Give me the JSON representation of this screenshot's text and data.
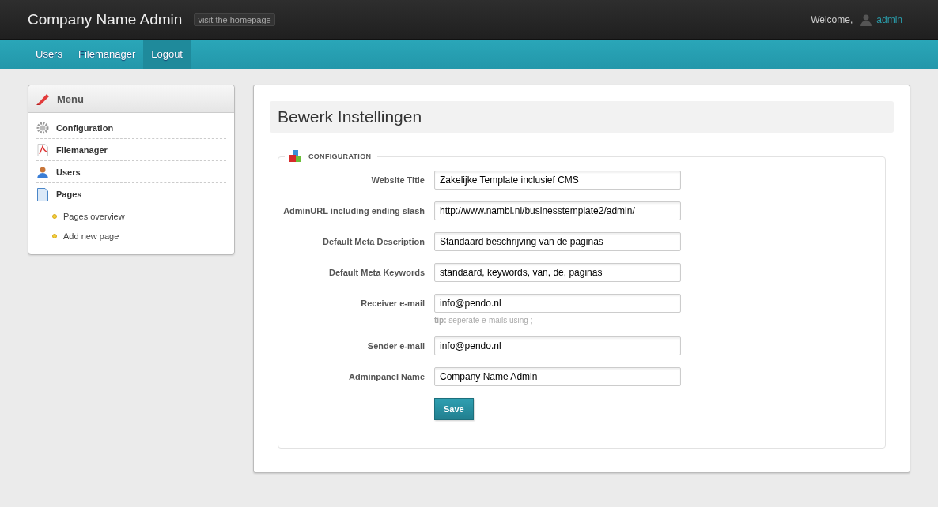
{
  "header": {
    "title": "Company Name Admin",
    "homepage_link": "visit the homepage",
    "welcome": "Welcome,",
    "user": "admin"
  },
  "nav": [
    {
      "label": "Users",
      "selected": false
    },
    {
      "label": "Filemanager",
      "selected": false
    },
    {
      "label": "Logout",
      "selected": true
    }
  ],
  "sidebar": {
    "title": "Menu",
    "items": [
      {
        "label": "Configuration",
        "kind": "gear"
      },
      {
        "label": "Filemanager",
        "kind": "pdf"
      },
      {
        "label": "Users",
        "kind": "user"
      },
      {
        "label": "Pages",
        "kind": "page",
        "children": [
          {
            "label": "Pages overview"
          },
          {
            "label": "Add new page"
          }
        ]
      }
    ]
  },
  "main": {
    "heading": "Bewerk Instellingen",
    "section": "CONFIGURATION",
    "fields": [
      {
        "label": "Website Title",
        "value": "Zakelijke Template inclusief CMS"
      },
      {
        "label": "AdminURL including ending slash",
        "value": "http://www.nambi.nl/businesstemplate2/admin/"
      },
      {
        "label": "Default Meta Description",
        "value": "Standaard beschrijving van de paginas"
      },
      {
        "label": "Default Meta Keywords",
        "value": "standaard, keywords, van, de, paginas"
      },
      {
        "label": "Receiver e-mail",
        "value": "info@pendo.nl",
        "hint": "**tip:** seperate e-mails using ;"
      },
      {
        "label": "Sender e-mail",
        "value": "info@pendo.nl"
      },
      {
        "label": "Adminpanel Name",
        "value": "Company Name Admin"
      }
    ],
    "save": "Save"
  }
}
